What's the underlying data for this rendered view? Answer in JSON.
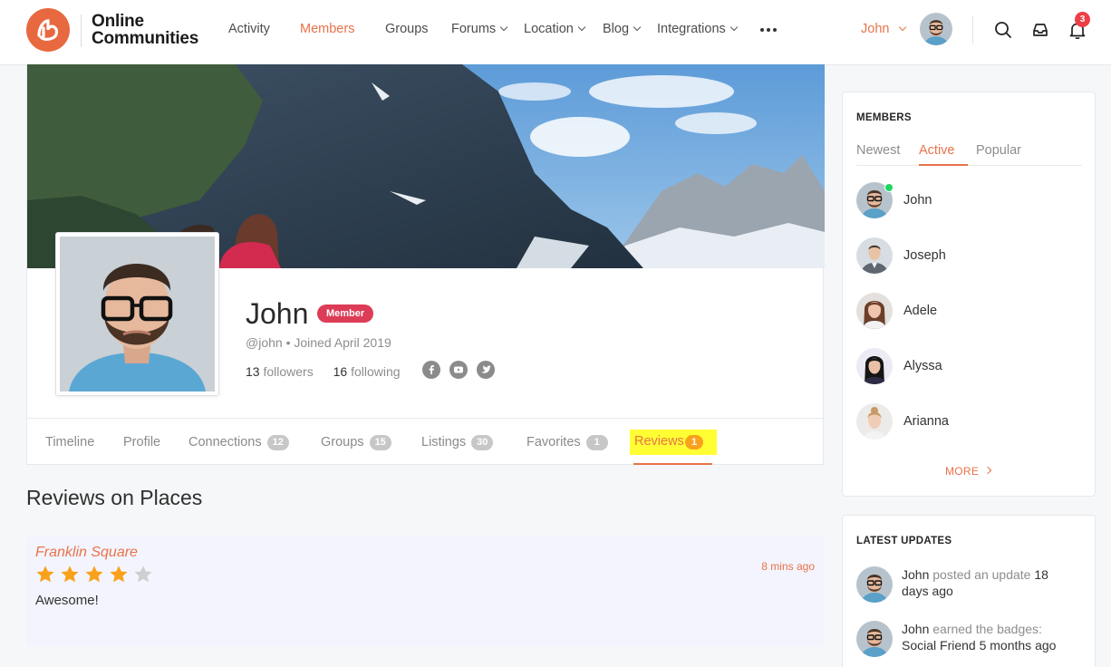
{
  "brand": {
    "line1": "Online",
    "line2": "Communities"
  },
  "nav": [
    {
      "label": "Activity"
    },
    {
      "label": "Members",
      "active": true
    },
    {
      "label": "Groups"
    },
    {
      "label": "Forums",
      "dropdown": true
    },
    {
      "label": "Location",
      "dropdown": true
    },
    {
      "label": "Blog",
      "dropdown": true
    },
    {
      "label": "Integrations",
      "dropdown": true
    }
  ],
  "header": {
    "user_name": "John",
    "notification_count": "3",
    "icons": [
      "search-icon",
      "inbox-icon",
      "bell-icon",
      "more-dots-icon"
    ]
  },
  "profile": {
    "name": "John",
    "role": "Member",
    "meta": "@john • Joined April 2019",
    "followers_count": "13",
    "followers_label": "followers",
    "following_count": "16",
    "following_label": "following",
    "social": [
      "facebook-icon",
      "youtube-icon",
      "twitter-icon"
    ]
  },
  "tabs": [
    {
      "label": "Timeline"
    },
    {
      "label": "Profile"
    },
    {
      "label": "Connections",
      "count": "12"
    },
    {
      "label": "Groups",
      "count": "15"
    },
    {
      "label": "Listings",
      "count": "30"
    },
    {
      "label": "Favorites",
      "count": "1"
    },
    {
      "label": "Reviews",
      "count": "1",
      "active": true
    }
  ],
  "reviews_section": {
    "title": "Reviews on Places",
    "items": [
      {
        "place": "Franklin Square",
        "time": "8 mins ago",
        "rating": 4,
        "max_rating": 5,
        "text": "Awesome!"
      }
    ]
  },
  "members_widget": {
    "title": "MEMBERS",
    "tabs": [
      {
        "label": "Newest"
      },
      {
        "label": "Active",
        "active": true
      },
      {
        "label": "Popular"
      }
    ],
    "members": [
      {
        "name": "John",
        "online": true
      },
      {
        "name": "Joseph"
      },
      {
        "name": "Adele"
      },
      {
        "name": "Alyssa"
      },
      {
        "name": "Arianna"
      }
    ],
    "more_label": "MORE"
  },
  "updates_widget": {
    "title": "LATEST UPDATES",
    "items": [
      {
        "who": "John",
        "action": "posted an update",
        "when": "18 days ago"
      },
      {
        "who": "John",
        "action": "earned the badges:",
        "when": "Social Friend 5 months ago"
      }
    ]
  },
  "colors": {
    "accent": "#e8734a",
    "badge_red": "#dd3c56",
    "star": "#f9a11b",
    "highlight": "#ffff33",
    "online": "#1ed760"
  }
}
